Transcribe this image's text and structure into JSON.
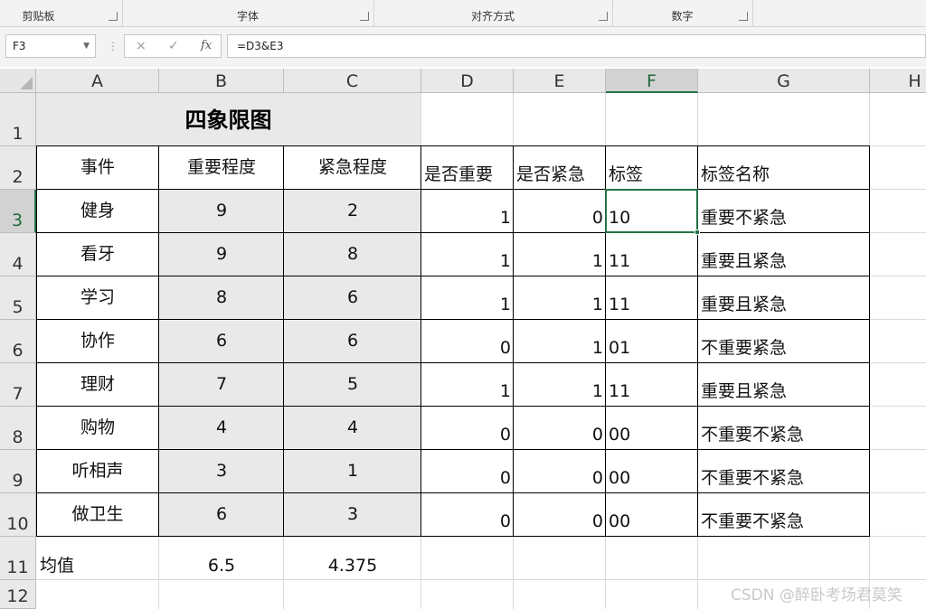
{
  "ribbon": {
    "groups": [
      "剪贴板",
      "字体",
      "对齐方式",
      "数字"
    ]
  },
  "formula_bar": {
    "name_box": "F3",
    "formula": "=D3&E3",
    "cancel_glyph": "×",
    "enter_glyph": "✓",
    "fx_label": "fx"
  },
  "columns": [
    "A",
    "B",
    "C",
    "D",
    "E",
    "F",
    "G",
    "H"
  ],
  "rows": [
    "1",
    "2",
    "3",
    "4",
    "5",
    "6",
    "7",
    "8",
    "9",
    "10",
    "11",
    "12"
  ],
  "sheet": {
    "title": "四象限图",
    "headers": {
      "a": "事件",
      "b": "重要程度",
      "c": "紧急程度",
      "d": "是否重要",
      "e": "是否紧急",
      "f": "标签",
      "g": "标签名称"
    },
    "data_rows": [
      {
        "event": "健身",
        "importance": "9",
        "urgency": "2",
        "is_important": "1",
        "is_urgent": "0",
        "tag": "10",
        "tag_name": "重要不紧急"
      },
      {
        "event": "看牙",
        "importance": "9",
        "urgency": "8",
        "is_important": "1",
        "is_urgent": "1",
        "tag": "11",
        "tag_name": "重要且紧急"
      },
      {
        "event": "学习",
        "importance": "8",
        "urgency": "6",
        "is_important": "1",
        "is_urgent": "1",
        "tag": "11",
        "tag_name": "重要且紧急"
      },
      {
        "event": "协作",
        "importance": "6",
        "urgency": "6",
        "is_important": "0",
        "is_urgent": "1",
        "tag": "01",
        "tag_name": "不重要紧急"
      },
      {
        "event": "理财",
        "importance": "7",
        "urgency": "5",
        "is_important": "1",
        "is_urgent": "1",
        "tag": "11",
        "tag_name": "重要且紧急"
      },
      {
        "event": "购物",
        "importance": "4",
        "urgency": "4",
        "is_important": "0",
        "is_urgent": "0",
        "tag": "00",
        "tag_name": "不重要不紧急"
      },
      {
        "event": "听相声",
        "importance": "3",
        "urgency": "1",
        "is_important": "0",
        "is_urgent": "0",
        "tag": "00",
        "tag_name": "不重要不紧急"
      },
      {
        "event": "做卫生",
        "importance": "6",
        "urgency": "3",
        "is_important": "0",
        "is_urgent": "0",
        "tag": "00",
        "tag_name": "不重要不紧急"
      }
    ],
    "average": {
      "label": "均值",
      "importance": "6.5",
      "urgency": "4.375"
    }
  },
  "active_cell": "F3",
  "watermark": "CSDN @醉卧考场君莫笑",
  "colors": {
    "accent": "#217346",
    "header_bg": "#e9e9e9",
    "shade": "#e9e9e9"
  }
}
